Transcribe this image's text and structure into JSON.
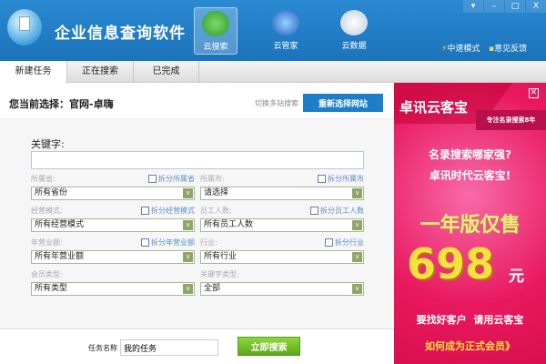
{
  "app": {
    "title": "企业信息查询软件"
  },
  "nav": [
    {
      "label": "云搜索",
      "icon": "radar-icon"
    },
    {
      "label": "云管家",
      "icon": "user-icon"
    },
    {
      "label": "云数据",
      "icon": "cloud-sync-icon"
    }
  ],
  "top_links": {
    "speed": "中速模式",
    "feedback": "意见反馈"
  },
  "window": {
    "menu": "▾",
    "min": "–",
    "max": "□",
    "close": "X"
  },
  "tabs": [
    "新建任务",
    "正在搜索",
    "已完成"
  ],
  "current": {
    "text": "您当前选择：官网-卓嗨",
    "switch": "切换多站搜索",
    "reselect": "重新选择网站"
  },
  "form": {
    "keyword_label": "关键字:",
    "keyword_value": "",
    "fields": [
      {
        "label": "所属省:",
        "split": "拆分所属省",
        "value": "所有省份"
      },
      {
        "label": "所属市:",
        "split": "拆分所属市",
        "value": "请选择"
      },
      {
        "label": "经营模式:",
        "split": "拆分经营模式",
        "value": "所有经营模式"
      },
      {
        "label": "员工人数:",
        "split": "拆分员工人数",
        "value": "所有员工人数"
      },
      {
        "label": "年营业额:",
        "split": "拆分年营业额",
        "value": "所有年营业额"
      },
      {
        "label": "行业:",
        "split": "拆分行业",
        "value": "所有行业"
      },
      {
        "label": "会员类型:",
        "value": "所有类型"
      },
      {
        "label": "关键字类型:",
        "value": "全部"
      }
    ]
  },
  "bottom": {
    "task_label": "任务名称",
    "task_value": "我的任务",
    "search": "立即搜索"
  },
  "ad": {
    "brand": "卓讯云客宝",
    "tag": "专注名录搜索8年",
    "q1": "名录搜索哪家强?",
    "q2": "卓讯时代云客宝!",
    "offer": "一年版仅售",
    "price": "698",
    "unit": "元",
    "slogan": "要找好客户  请用云客宝",
    "link": "如何成为正式会员》",
    "close": "✕"
  },
  "colors": {
    "brand_blue": "#1e7fc8",
    "ad_pink": "#e8185e",
    "go_green": "#6cbc24",
    "price_yellow": "#f8e040"
  }
}
